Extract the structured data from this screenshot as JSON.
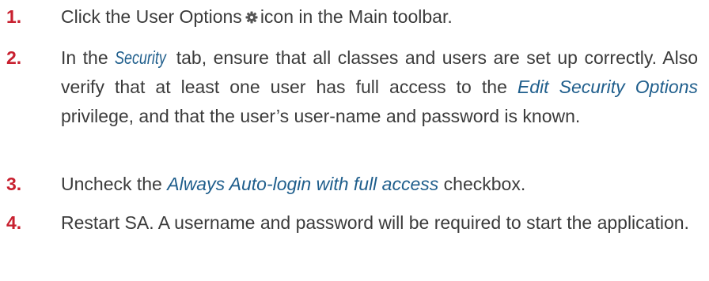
{
  "steps": [
    {
      "number": "1.",
      "before": "Click the User Options",
      "icon": "gear-icon",
      "after": "icon in the Main toolbar."
    },
    {
      "number": "2.",
      "before": "In the ",
      "tab_name": "Security",
      "middle": " tab, ensure that all classes and users are set up correctly. Also verify that at least one user has full access to the ",
      "privilege_name": "Edit Security Options",
      "after": " privilege, and that the user’s user-name and password is known."
    },
    {
      "number": "3.",
      "before": "Uncheck the ",
      "checkbox_name": "Always Auto-login with full access",
      "after": " checkbox."
    },
    {
      "number": "4.",
      "text": "Restart SA. A username and password will be required to start the application."
    }
  ],
  "colors": {
    "number": "#c8202f",
    "emphasis": "#1f5e8c",
    "body_text": "#3b3b3b"
  }
}
